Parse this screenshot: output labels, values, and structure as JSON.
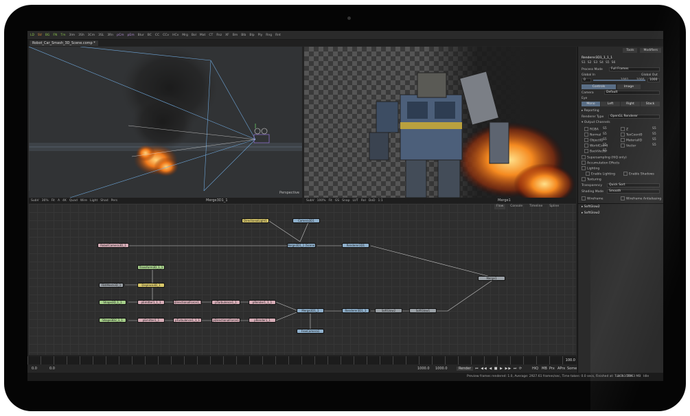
{
  "toolbar": {
    "buttons": [
      {
        "label": "LD",
        "color": "green"
      },
      {
        "label": "SV",
        "color": "orange"
      },
      {
        "label": "BG",
        "color": "green"
      },
      {
        "label": "FN",
        "color": "green"
      },
      {
        "label": "Tm",
        "color": "green"
      },
      {
        "label": "3Im",
        "color": ""
      },
      {
        "label": "3Sh",
        "color": ""
      },
      {
        "label": "3Cm",
        "color": ""
      },
      {
        "label": "3SL",
        "color": ""
      },
      {
        "label": "3Rn",
        "color": ""
      },
      {
        "label": "pCm",
        "color": "purple"
      },
      {
        "label": "pEm",
        "color": "purple"
      },
      {
        "label": "Blur",
        "color": ""
      },
      {
        "label": "BC",
        "color": ""
      },
      {
        "label": "CC",
        "color": ""
      },
      {
        "label": "CCv",
        "color": ""
      },
      {
        "label": "HCv",
        "color": ""
      },
      {
        "label": "Mrg",
        "color": ""
      },
      {
        "label": "Bol",
        "color": ""
      },
      {
        "label": "Mat",
        "color": ""
      },
      {
        "label": "CT",
        "color": ""
      },
      {
        "label": "Rsz",
        "color": ""
      },
      {
        "label": "XF",
        "color": ""
      },
      {
        "label": "Bm",
        "color": ""
      },
      {
        "label": "Blb",
        "color": ""
      },
      {
        "label": "Blp",
        "color": ""
      },
      {
        "label": "Ply",
        "color": ""
      },
      {
        "label": "Rng",
        "color": ""
      },
      {
        "label": "Rnt",
        "color": ""
      }
    ]
  },
  "composition_tab": "Robot_Car_Smash_3D_Scene.comp *",
  "viewer_left": {
    "toolbar": [
      "SubV",
      "36%",
      "Fit",
      "A",
      "4K",
      "Quad",
      "Wire",
      "Light",
      "Shad",
      "Pers"
    ],
    "center_label": "Merge3D1_1",
    "corner_label": "Perspective"
  },
  "viewer_right": {
    "toolbar": [
      "SubV",
      "100%",
      "Fit",
      "GS",
      "Snap",
      "LUT",
      "RoI",
      "DoD",
      "1:1"
    ],
    "center_label": "Merge1"
  },
  "flow_tabs": [
    "Flow",
    "Console",
    "Timeline",
    "Spline"
  ],
  "nodes": [
    {
      "label": "DirectionalLight1",
      "type": "yellow"
    },
    {
      "label": "Camera3D1",
      "type": "blue"
    },
    {
      "label": "RobotCamera3D_1",
      "type": "pink"
    },
    {
      "label": "Merge3D1_1 [Scene]",
      "type": "blue"
    },
    {
      "label": "Renderer3D1",
      "type": "blue"
    },
    {
      "label": "Transform3D_1_1",
      "type": "green"
    },
    {
      "label": "FBXMesh3D_1",
      "type": "gray"
    },
    {
      "label": "Displace3D_1",
      "type": "yellow"
    },
    {
      "label": "Shape3D_1_1",
      "type": "green"
    },
    {
      "label": "pEmitter1_1_1",
      "type": "pink"
    },
    {
      "label": "pDirectionalForce1_1",
      "type": "pink"
    },
    {
      "label": "pTurbulence1_1",
      "type": "pink"
    },
    {
      "label": "pRender1_1_1",
      "type": "pink"
    },
    {
      "label": "Shape3D2_1_1",
      "type": "green"
    },
    {
      "label": "pEmitter1_1",
      "type": "pink"
    },
    {
      "label": "pTurbulence1_1_1",
      "type": "pink"
    },
    {
      "label": "pDirectionalForce1",
      "type": "pink"
    },
    {
      "label": "pRender1_1",
      "type": "pink"
    },
    {
      "label": "Merge3D1_1",
      "type": "blue"
    },
    {
      "label": "Renderer3D1_1",
      "type": "blue"
    },
    {
      "label": "SoftGlow2",
      "type": "gray"
    },
    {
      "label": "SoftGlow1",
      "type": "gray"
    },
    {
      "label": "Merge1",
      "type": "gray"
    },
    {
      "label": "FreeCamera1",
      "type": "blue"
    }
  ],
  "timeline": {
    "end_value": "100.0"
  },
  "transport": {
    "start": "0.0",
    "render_start": "0.0",
    "current": "1000.0",
    "render_end": "1000.0",
    "render_button": "Render",
    "buttons": [
      "HiQ",
      "MB",
      "Prx",
      "APrx",
      "Some"
    ]
  },
  "status": {
    "message": "Preview frames rendered: 1.0,  Average: 2927.61 frames/sec,  Time taken: 0.0 secs,  Finished at: Tue 3:15PM",
    "memory": "16% - 5263 MB",
    "state": "Idle"
  },
  "inspector": {
    "tabs": [
      "Tools",
      "Modifiers"
    ],
    "tool_name": "Renderer3D1_1_1_1",
    "slots": [
      "S1",
      "S2",
      "S3",
      "S4",
      "S5",
      "S6"
    ],
    "process_mode_label": "Process Mode",
    "process_mode_value": "Full Frames",
    "global_in_label": "Global In",
    "global_out_label": "Global Out",
    "global_in_value": "0",
    "global_mid_value": "1001",
    "global_mid_end": "1000",
    "global_out_value": "1000",
    "subtabs": [
      "Controls",
      "Image"
    ],
    "camera_label": "Camera",
    "camera_value": "Default",
    "eye_label": "Eye",
    "eye_options": [
      "Mono",
      "Left",
      "Right",
      "Stack"
    ],
    "reporting_label": "Reporting",
    "renderer_type_label": "Renderer Type",
    "renderer_type_value": "OpenGL Renderer",
    "output_channels_label": "Output Channels",
    "channels": [
      [
        "RGBA",
        "S5",
        "Z",
        "S5"
      ],
      [
        "Normal",
        "S5",
        "TexCoord0",
        "S5"
      ],
      [
        "ObjectID",
        "S5",
        "MaterialID",
        "S5"
      ],
      [
        "WorldCoord",
        "S5",
        "Vector",
        "S5"
      ],
      [
        "BackVector",
        "S5",
        "",
        ""
      ]
    ],
    "options": [
      "Supersampling (HiQ only)",
      "Accumulation Effects",
      "Lighting"
    ],
    "enable_lighting": "Enable Lighting",
    "enable_shadows": "Enable Shadows",
    "texturing": "Texturing",
    "transparency_label": "Transparency",
    "transparency_value": "Quick Sort",
    "shading_mode_label": "Shading Mode",
    "shading_mode_value": "Smooth",
    "wireframe": "Wireframe",
    "wireframe_aa": "Wireframe Antialiasing",
    "collapsed_tools": [
      "SoftGlow2",
      "SoftGlow2"
    ]
  }
}
